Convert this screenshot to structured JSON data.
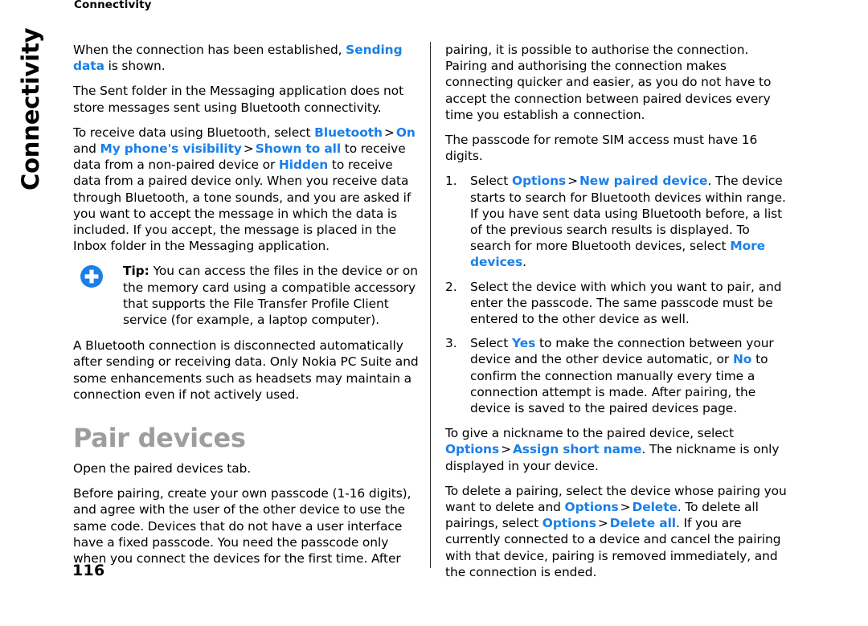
{
  "document": {
    "running_head": "Connectivity",
    "chapter_tab": "Connectivity",
    "page_number": "116"
  },
  "colors": {
    "ui_link": "#1a7fe8",
    "heading_gray": "#9d9d9d",
    "body_text": "#000000",
    "tip_icon_blue": "#1a7fe8",
    "column_rule": "#2b2b2b"
  },
  "left_column": {
    "p1": {
      "t1": "When the connection has been established, ",
      "ui1": "Sending data",
      "t2": " is shown."
    },
    "p2": {
      "t1": "The Sent folder in the Messaging application does not store messages sent using Bluetooth connectivity."
    },
    "p3": {
      "t1": "To receive data using Bluetooth, select ",
      "ui1": "Bluetooth",
      "gt1": ">",
      "ui2": "On",
      "t2": " and ",
      "ui3": "My phone's visibility",
      "gt2": ">",
      "ui4": "Shown to all",
      "t3": " to receive data from a non-paired device or ",
      "ui5": "Hidden",
      "t4": " to receive data from a paired device only. When you receive data through Bluetooth, a tone sounds, and you are asked if you want to accept the message in which the data is included. If you accept, the message is placed in the Inbox folder in the Messaging application."
    },
    "tip": {
      "icon": "tip-plus-circle-icon",
      "label": "Tip:",
      "text": " You can access the files in the device or on the memory card using a compatible accessory that supports the File Transfer Profile Client service (for example, a laptop computer)."
    },
    "p4": {
      "t1": "A Bluetooth connection is disconnected automatically after sending or receiving data. Only Nokia PC Suite and some enhancements such as headsets may maintain a connection even if not actively used."
    },
    "heading": "Pair devices",
    "p5": {
      "t1": "Open the paired devices tab."
    },
    "p6": {
      "t1": "Before pairing, create your own passcode (1-16 digits), and agree with the user of the other device to use the same code. Devices that do not have a user interface have a fixed passcode. You need the passcode only when you connect the devices for the first time. After"
    }
  },
  "right_column": {
    "p1": {
      "t1": "pairing, it is possible to authorise the connection. Pairing and authorising the connection makes connecting quicker and easier, as you do not have to accept the connection between paired devices every time you establish a connection."
    },
    "p2": {
      "t1": "The passcode for remote SIM access must have 16 digits."
    },
    "steps": [
      {
        "number": "1.",
        "t1": "Select ",
        "ui1": "Options",
        "gt1": ">",
        "ui2": "New paired device",
        "t2": ". The device starts to search for Bluetooth devices within range. If you have sent data using Bluetooth before, a list of the previous search results is displayed. To search for more Bluetooth devices, select ",
        "ui3": "More devices",
        "t3": "."
      },
      {
        "number": "2.",
        "t1": "Select the device with which you want to pair, and enter the passcode. The same passcode must be entered to the other device as well."
      },
      {
        "number": "3.",
        "t1": "Select ",
        "ui1": "Yes",
        "t2": " to make the connection between your device and the other device automatic, or ",
        "ui2": "No",
        "t3": " to confirm the connection manually every time a connection attempt is made. After pairing, the device is saved to the paired devices page."
      }
    ],
    "p3": {
      "t1": "To give a nickname to the paired device, select ",
      "ui1": "Options",
      "gt1": ">",
      "ui2": "Assign short name",
      "t2": ". The nickname is only displayed in your device."
    },
    "p4": {
      "t1": "To delete a pairing, select the device whose pairing you want to delete and ",
      "ui1": "Options",
      "gt1": ">",
      "ui2": "Delete",
      "t2": ". To delete all pairings, select ",
      "ui3": "Options",
      "gt2": ">",
      "ui4": "Delete all",
      "t3": ". If you are currently connected to a device and cancel the pairing with that device, pairing is removed immediately, and the connection is ended."
    }
  }
}
